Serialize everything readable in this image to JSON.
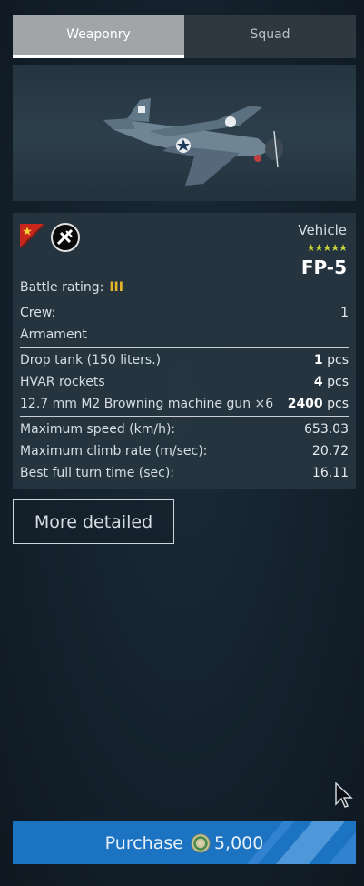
{
  "tabs": [
    {
      "label": "Weaponry",
      "active": true
    },
    {
      "label": "Squad",
      "active": false
    }
  ],
  "vehicle": {
    "label": "Vehicle",
    "stars": "★★★★★",
    "name": "FP-5",
    "country_flag": "china-flag-icon",
    "role_icon": "fighter-icon"
  },
  "stats": {
    "battle_rating_label": "Battle rating:",
    "battle_rating_value": "III",
    "crew_label": "Crew:",
    "crew_value": "1",
    "armament_label": "Armament"
  },
  "armament": [
    {
      "name": "Drop tank (150 liters.)",
      "count": "1",
      "unit": " pcs"
    },
    {
      "name": "HVAR rockets",
      "count": "4",
      "unit": " pcs"
    },
    {
      "name": "12.7 mm M2 Browning machine gun ×6",
      "count": "2400",
      "unit": " pcs"
    }
  ],
  "performance": [
    {
      "label": "Maximum speed (km/h):",
      "value": "653.03"
    },
    {
      "label": "Maximum climb rate (m/sec):",
      "value": "20.72"
    },
    {
      "label": "Best full turn time (sec):",
      "value": "16.11"
    }
  ],
  "more_button": "More detailed",
  "purchase": {
    "label": "Purchase",
    "price": "5,000",
    "currency_icon": "golden-eagle-coin-icon"
  },
  "colors": {
    "accent_blue": "#1c73c2",
    "battle_rating": "#e7b72b",
    "stars": "#c8d43a"
  }
}
